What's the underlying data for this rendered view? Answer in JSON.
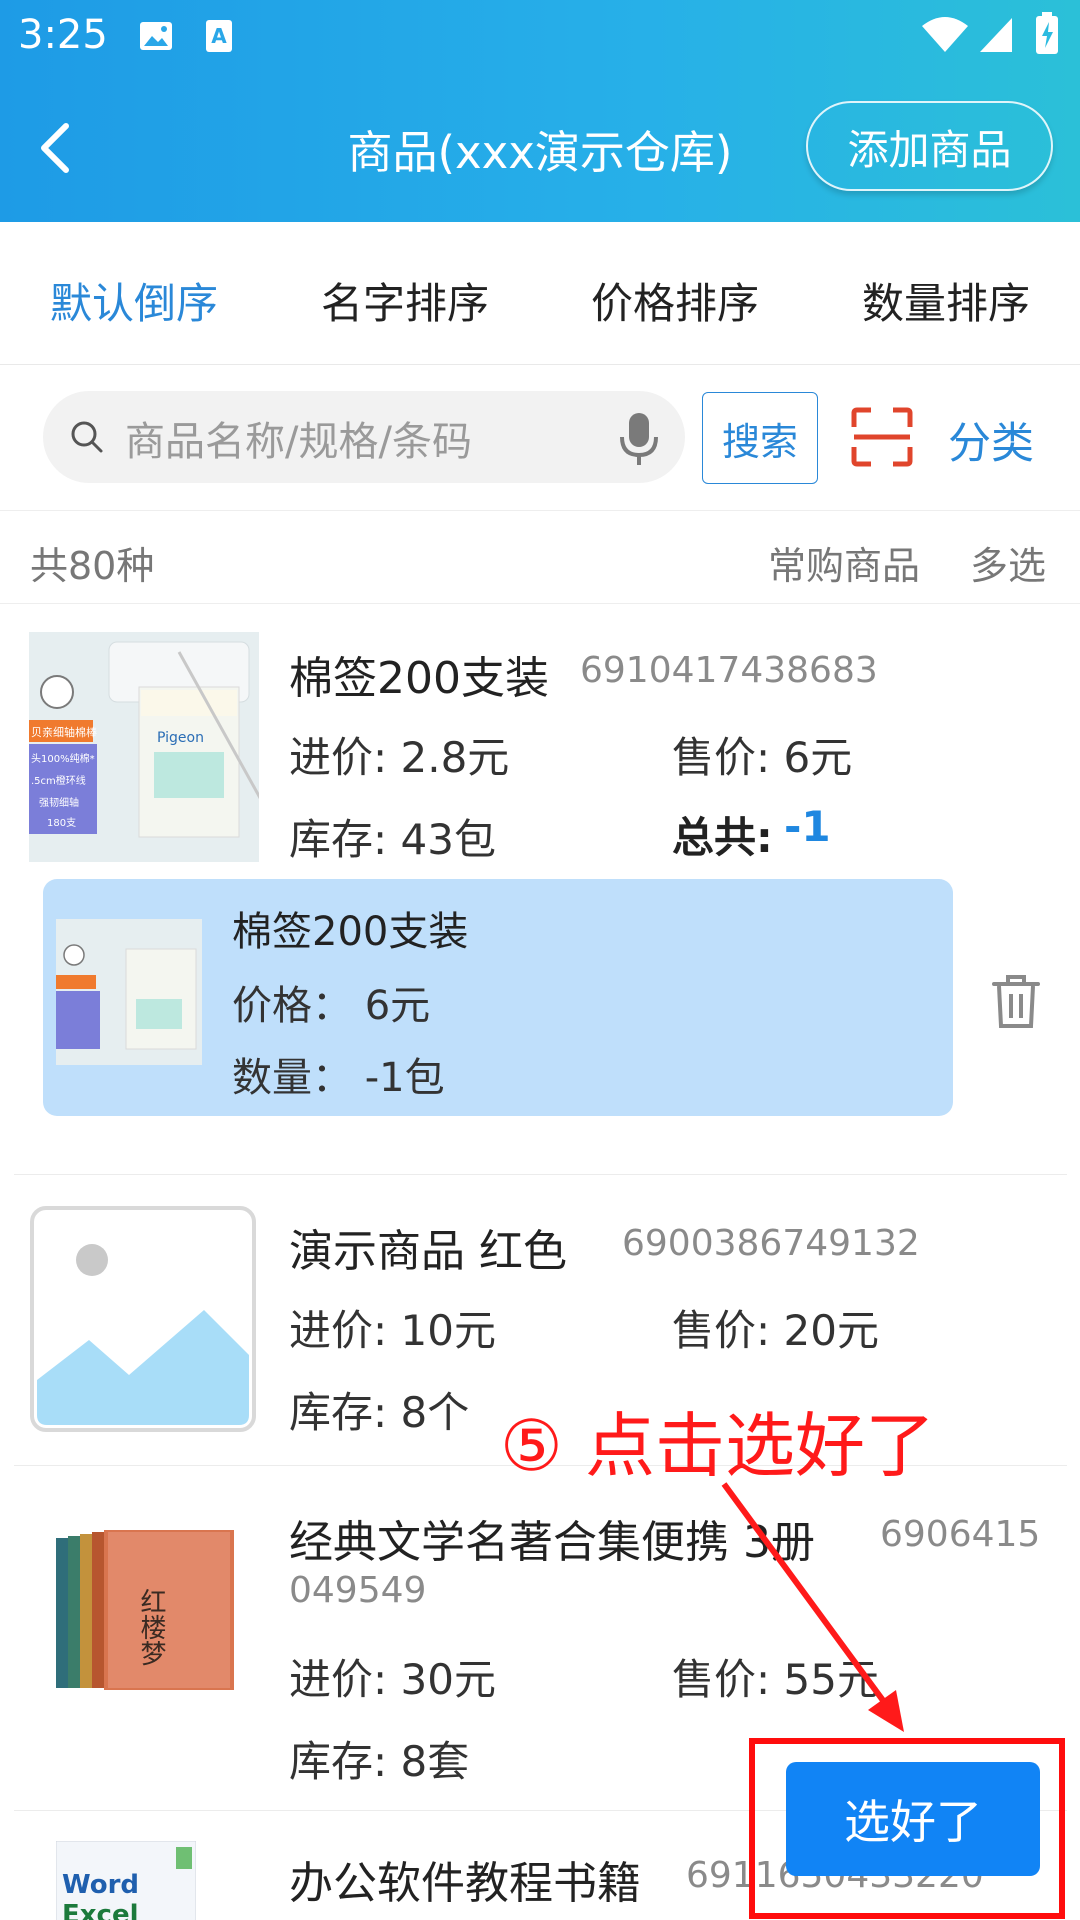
{
  "status_bar": {
    "time": "3:25"
  },
  "header": {
    "title": "商品(xxx演示仓库)",
    "add_button": "添加商品"
  },
  "sort_tabs": [
    "默认倒序",
    "名字排序",
    "价格排序",
    "数量排序"
  ],
  "search": {
    "placeholder": "商品名称/规格/条码",
    "button": "搜索",
    "category": "分类"
  },
  "list_header": {
    "count": "共80种",
    "frequent": "常购商品",
    "multi_select": "多选"
  },
  "products": [
    {
      "name": "棉签200支装",
      "code": "6910417438683",
      "purchase_price": "进价: 2.8元",
      "sale_price": "售价: 6元",
      "stock": "库存: 43包",
      "total_label": "总共:",
      "total_value": "-1"
    },
    {
      "name": "演示商品  红色",
      "code": "6900386749132",
      "purchase_price": "进价: 10元",
      "sale_price": "售价: 20元",
      "stock": "库存: 8个"
    },
    {
      "name": "经典文学名著合集便携  3册",
      "code_line1": "6906415",
      "code_line2": "049549",
      "purchase_price": "进价: 30元",
      "sale_price": "售价: 55元",
      "stock": "库存: 8套"
    },
    {
      "name": "办公软件教程书籍",
      "code": "6911650433220"
    }
  ],
  "selected_item": {
    "name": "棉签200支装",
    "price": "价格：   6元",
    "quantity": "数量：  -1包"
  },
  "annotation": "⑤ 点击选好了",
  "done_button": "选好了",
  "thumbnail_text": {
    "cotton_tag": "贝亲细轴棉棒",
    "cotton_brand": "Pigeon",
    "cotton_lines": [
      "头100%纯棉*",
      ".5cm橙环线",
      "强韧细轴",
      "180支"
    ],
    "book_title": "红楼梦",
    "office_lines": [
      "Word",
      "Excel"
    ]
  },
  "colors": {
    "accent": "#2a88d8",
    "header_start": "#1e9be6",
    "header_end": "#2bc0d8",
    "total": "#1f87e0",
    "annotation": "#ff1a1a",
    "done": "#1184f5"
  }
}
